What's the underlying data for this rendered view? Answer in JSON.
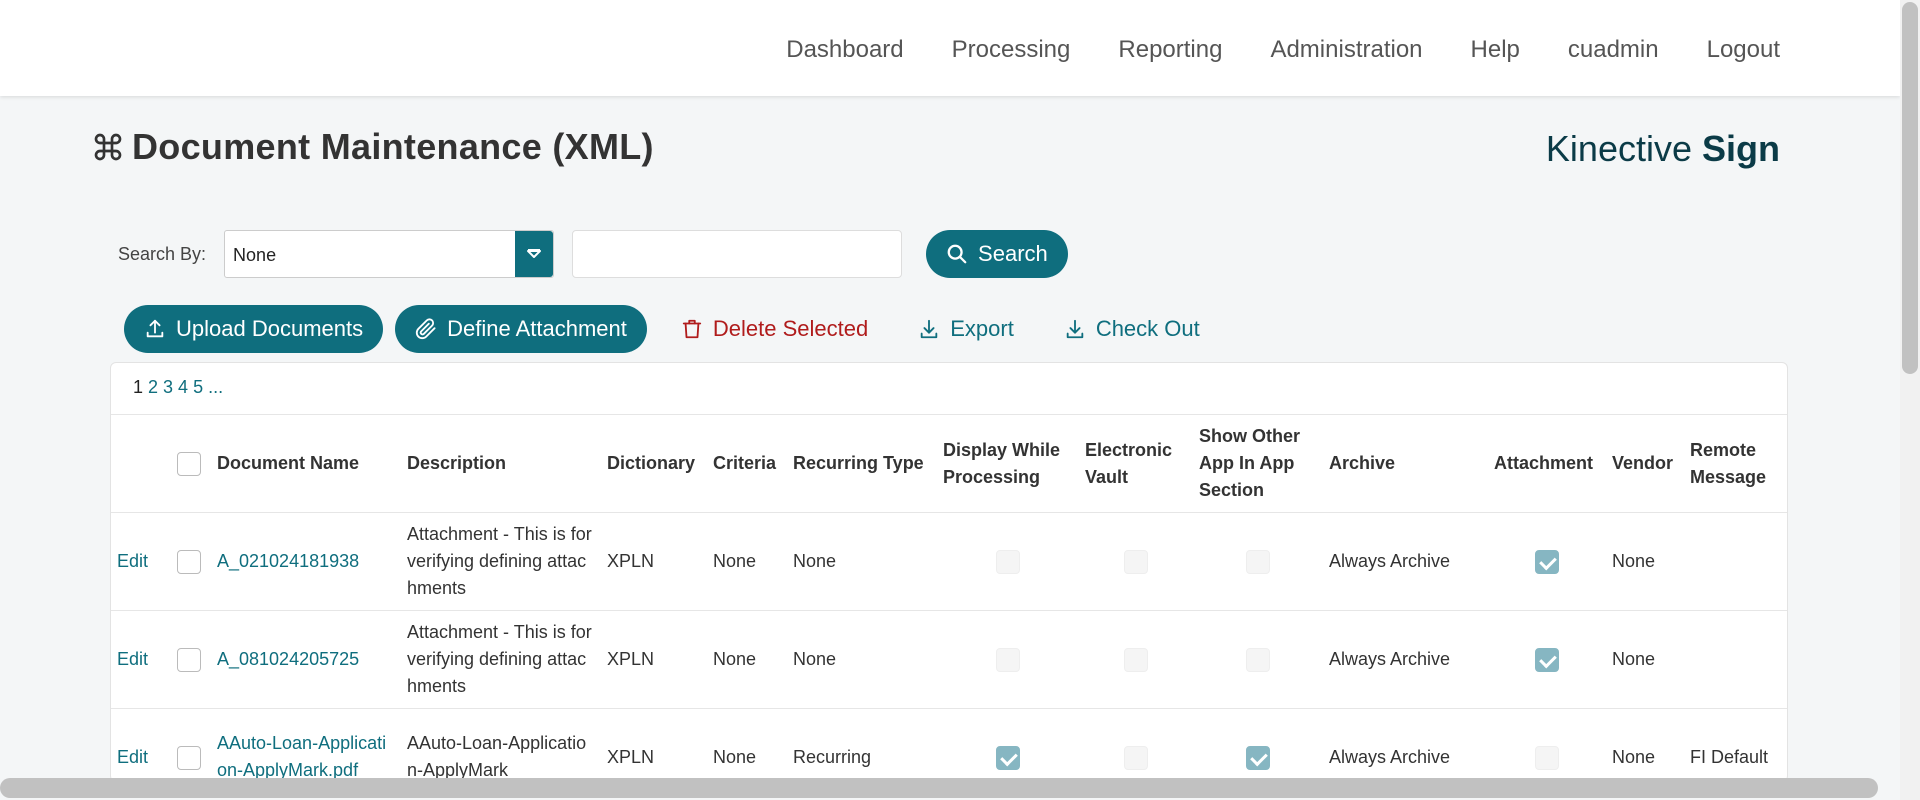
{
  "nav": {
    "items": [
      "Dashboard",
      "Processing",
      "Reporting",
      "Administration",
      "Help",
      "cuadmin",
      "Logout"
    ]
  },
  "page": {
    "title": "Document Maintenance (XML)",
    "title_icon": "command-icon",
    "brand_light": "Kinective ",
    "brand_bold": "Sign"
  },
  "search": {
    "label": "Search By:",
    "selected": "None",
    "text_value": "",
    "button": "Search"
  },
  "actions": {
    "upload": "Upload Documents",
    "define": "Define Attachment",
    "delete": "Delete Selected",
    "export": "Export",
    "checkout": "Check Out"
  },
  "pager": {
    "pages": [
      "1",
      "2",
      "3",
      "4",
      "5",
      "..."
    ],
    "current": "1"
  },
  "table": {
    "headers": {
      "name": "Document Name",
      "description": "Description",
      "dictionary": "Dictionary",
      "criteria": "Criteria",
      "recurring": "Recurring Type",
      "display": "Display While Processing",
      "vault": "Electronic Vault",
      "showother": "Show Other App In App Section",
      "archive": "Archive",
      "attachment": "Attachment",
      "vendor": "Vendor",
      "remote": "Remote Message"
    },
    "edit_label": "Edit",
    "rows": [
      {
        "name": "A_021024181938",
        "description": "Attachment - This is for verifying defining attachments",
        "dictionary": "XPLN",
        "criteria": "None",
        "recurring": "None",
        "display": false,
        "vault": false,
        "showother": false,
        "archive": "Always Archive",
        "attachment": true,
        "vendor": "None",
        "remote": ""
      },
      {
        "name": "A_081024205725",
        "description": "Attachment - This is for verifying defining attachments",
        "dictionary": "XPLN",
        "criteria": "None",
        "recurring": "None",
        "display": false,
        "vault": false,
        "showother": false,
        "archive": "Always Archive",
        "attachment": true,
        "vendor": "None",
        "remote": ""
      },
      {
        "name": "AAuto-Loan-Application-ApplyMark.pdf",
        "description": "AAuto-Loan-Application-ApplyMark",
        "dictionary": "XPLN",
        "criteria": "None",
        "recurring": "Recurring",
        "display": true,
        "vault": false,
        "showother": true,
        "archive": "Always Archive",
        "attachment": false,
        "vendor": "None",
        "remote": "FI Default"
      }
    ]
  },
  "colors": {
    "primary": "#0f6e7e",
    "danger": "#b01c1c",
    "brand": "#0b3b47"
  }
}
